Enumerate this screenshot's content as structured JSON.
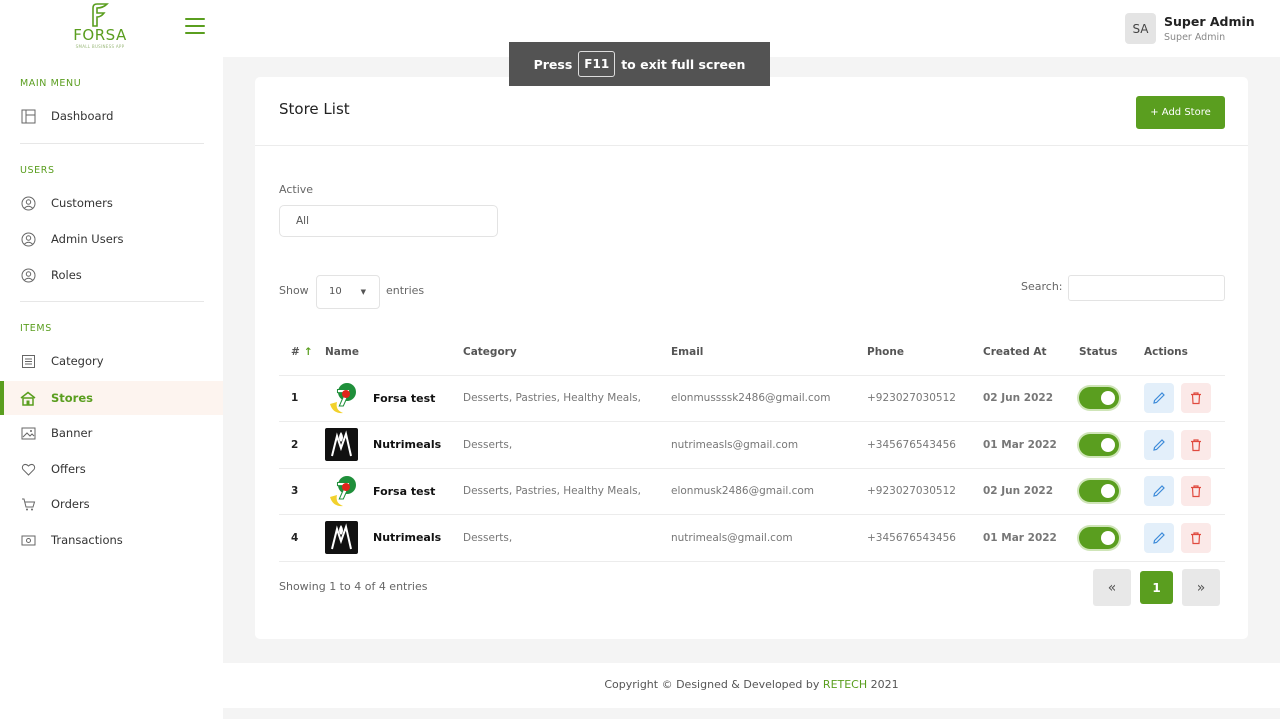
{
  "brand": {
    "name": "FORSA",
    "tagline": "SMALL BUSINESS APP"
  },
  "colors": {
    "accent": "#5a9e1f",
    "edit": "#3d8bd9",
    "delete": "#e04a3f"
  },
  "sidebar": {
    "sections": [
      {
        "title": "MAIN MENU"
      },
      {
        "title": "USERS"
      },
      {
        "title": "ITEMS"
      }
    ],
    "items": [
      {
        "label": "Dashboard",
        "icon": "dashboard-icon"
      },
      {
        "label": "Customers",
        "icon": "customers-icon"
      },
      {
        "label": "Admin Users",
        "icon": "admin-users-icon"
      },
      {
        "label": "Roles",
        "icon": "roles-icon"
      },
      {
        "label": "Category",
        "icon": "category-icon"
      },
      {
        "label": "Stores",
        "icon": "store-icon",
        "active": true
      },
      {
        "label": "Banner",
        "icon": "image-icon"
      },
      {
        "label": "Offers",
        "icon": "heart-icon"
      },
      {
        "label": "Orders",
        "icon": "cart-icon"
      },
      {
        "label": "Transactions",
        "icon": "wallet-icon"
      }
    ]
  },
  "header": {
    "user": {
      "initials": "SA",
      "name": "Super Admin",
      "role": "Super Admin"
    },
    "fullscreen_banner": {
      "before": "Press",
      "key": "F11",
      "after": "to exit full screen"
    }
  },
  "page": {
    "title": "Store List",
    "add_button": "+ Add Store",
    "filter": {
      "label": "Active",
      "value": "All"
    },
    "table_controls": {
      "show": "Show",
      "length": "10",
      "entries": "entries",
      "search_label": "Search:",
      "search_value": ""
    },
    "columns": [
      "#",
      "Name",
      "Category",
      "Email",
      "Phone",
      "Created At",
      "Status",
      "Actions"
    ],
    "rows": [
      {
        "num": "1",
        "name": "Forsa test",
        "logo": "7up-logo",
        "category": "Desserts, Pastries, Healthy Meals,",
        "email": "elonmussssk2486@gmail.com",
        "phone": "+923027030512",
        "created": "02 Jun 2022",
        "status": true
      },
      {
        "num": "2",
        "name": "Nutrimeals",
        "logo": "nutrimeals-logo",
        "category": "Desserts,",
        "email": "nutrimeasls@gmail.com",
        "phone": "+345676543456",
        "created": "01 Mar 2022",
        "status": true
      },
      {
        "num": "3",
        "name": "Forsa test",
        "logo": "7up-logo",
        "category": "Desserts, Pastries, Healthy Meals,",
        "email": "elonmusk2486@gmail.com",
        "phone": "+923027030512",
        "created": "02 Jun 2022",
        "status": true
      },
      {
        "num": "4",
        "name": "Nutrimeals",
        "logo": "nutrimeals-logo",
        "category": "Desserts,",
        "email": "nutrimeals@gmail.com",
        "phone": "+345676543456",
        "created": "01 Mar 2022",
        "status": true
      }
    ],
    "info": "Showing 1 to 4 of 4 entries",
    "pagination": {
      "prev": "«",
      "current": "1",
      "next": "»"
    }
  },
  "footer": {
    "text": "Copyright © Designed & Developed by",
    "brand": "RETECH",
    "year": "2021"
  }
}
